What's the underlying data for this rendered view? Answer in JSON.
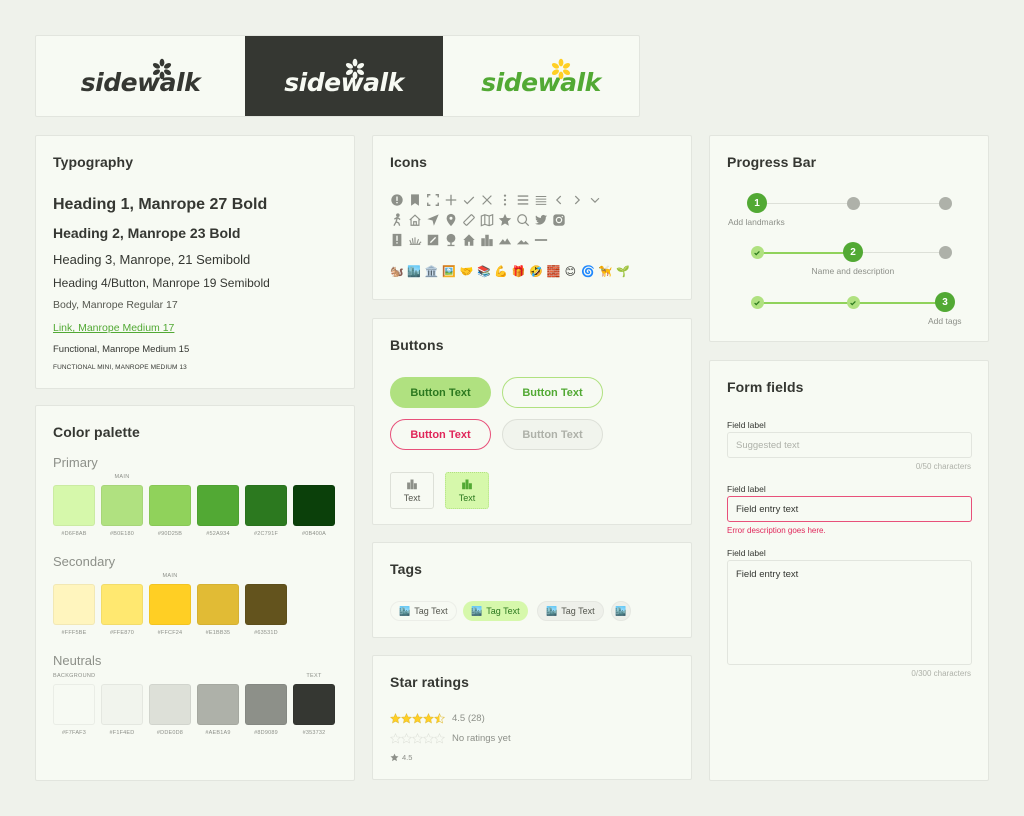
{
  "logos": {
    "wordmark": "sidewalk",
    "variants": [
      {
        "name": "dark-on-light",
        "text_color": "#353732",
        "flower_color": "#353732",
        "background": "#f7faf3"
      },
      {
        "name": "light-on-dark",
        "text_color": "#f7faf3",
        "flower_color": "#f7faf3",
        "background": "#353732"
      },
      {
        "name": "brand-color",
        "text_color": "#52a934",
        "flower_color": "#ffcf24",
        "background": "#f7faf3"
      }
    ]
  },
  "typography": {
    "title": "Typography",
    "samples": {
      "h1": "Heading 1, Manrope 27 Bold",
      "h2": "Heading 2, Manrope 23 Bold",
      "h3": "Heading 3, Manrope, 21 Semibold",
      "h4": "Heading 4/Button, Manrope 19 Semibold",
      "body": "Body, Manrope Regular 17",
      "link": "Link, Manrope Medium 17",
      "functional": "Functional, Manrope Medium 15",
      "functional_mini": "Functional mini, Manrope Medium 13"
    }
  },
  "palette": {
    "title": "Color palette",
    "primary": {
      "label": "Primary",
      "swatches": [
        {
          "hex": "#D6F8AB",
          "tag": ""
        },
        {
          "hex": "#B0E180",
          "tag": "MAIN"
        },
        {
          "hex": "#90D25B",
          "tag": ""
        },
        {
          "hex": "#52A934",
          "tag": ""
        },
        {
          "hex": "#2C791F",
          "tag": ""
        },
        {
          "hex": "#0B400A",
          "tag": ""
        }
      ]
    },
    "secondary": {
      "label": "Secondary",
      "swatches": [
        {
          "hex": "#FFF5BE",
          "tag": ""
        },
        {
          "hex": "#FFE870",
          "tag": ""
        },
        {
          "hex": "#FFCF24",
          "tag": "MAIN"
        },
        {
          "hex": "#E1BB35",
          "tag": ""
        },
        {
          "hex": "#63531D",
          "tag": ""
        }
      ]
    },
    "neutrals": {
      "label": "Neutrals",
      "swatches": [
        {
          "hex": "#F7FAF3",
          "tag": "BACKGROUND"
        },
        {
          "hex": "#F1F4ED",
          "tag": ""
        },
        {
          "hex": "#DDE0D8",
          "tag": ""
        },
        {
          "hex": "#AEB1A9",
          "tag": ""
        },
        {
          "hex": "#8D9089",
          "tag": ""
        },
        {
          "hex": "#353732",
          "tag": "TEXT"
        }
      ]
    }
  },
  "icons": {
    "title": "Icons",
    "row1": [
      "alert-circle-icon",
      "bookmark-icon",
      "fullscreen-icon",
      "plus-icon",
      "check-icon",
      "close-icon",
      "more-vertical-icon",
      "menu-icon",
      "menu-thin-icon",
      "chevron-left-icon",
      "chevron-right-icon",
      "chevron-down-icon"
    ],
    "row2": [
      "walk-icon",
      "home-icon",
      "navigation-icon",
      "map-pin-icon",
      "ruler-icon",
      "map-icon",
      "star-icon",
      "search-icon",
      "twitter-icon",
      "instagram-icon"
    ],
    "row3": [
      "info-sign-icon",
      "grass-icon",
      "edit-square-icon",
      "tree-icon",
      "house-icon",
      "buildings-icon",
      "mountain-icon",
      "hills-icon",
      "minus-icon"
    ],
    "emoji": [
      "🐿️",
      "🏙️",
      "🏛️",
      "🖼️",
      "🤝",
      "📚",
      "💪",
      "🎁",
      "🤣",
      "🧱",
      "😊",
      "🌀",
      "🦮",
      "🌱"
    ]
  },
  "buttons": {
    "title": "Buttons",
    "primary_label": "Button Text",
    "secondary_label": "Button Text",
    "danger_label": "Button Text",
    "disabled_label": "Button Text",
    "tile_default_label": "Text",
    "tile_selected_label": "Text"
  },
  "tags": {
    "title": "Tags",
    "items": [
      {
        "label": "Tag Text",
        "icon": "🏙️",
        "state": "default"
      },
      {
        "label": "Tag Text",
        "icon": "🏙️",
        "state": "selected"
      },
      {
        "label": "Tag Text",
        "icon": "🏙️",
        "state": "hover"
      },
      {
        "label": "",
        "icon": "🏙️",
        "state": "icon-only"
      }
    ]
  },
  "stars": {
    "title": "Star ratings",
    "rated": {
      "rating": 4.5,
      "max": 5,
      "text": "4.5 (28)"
    },
    "empty": {
      "rating": 0,
      "max": 5,
      "text": "No ratings yet"
    },
    "compact": {
      "rating": 4.5,
      "text": "4.5"
    }
  },
  "progress": {
    "title": "Progress Bar",
    "steps": [
      "Add landmarks",
      "Name and description",
      "Add tags"
    ],
    "examples": [
      {
        "current_step": 1,
        "label": "Add landmarks"
      },
      {
        "current_step": 2,
        "label": "Name and description"
      },
      {
        "current_step": 3,
        "label": "Add tags"
      }
    ]
  },
  "form": {
    "title": "Form fields",
    "field1": {
      "label": "Field label",
      "value": "",
      "placeholder": "Suggested text",
      "counter": "0/50 characters"
    },
    "field2": {
      "label": "Field label",
      "value": "Field entry text",
      "error": "Error description goes here."
    },
    "field3": {
      "label": "Field label",
      "value": "Field entry text",
      "counter": "0/300 characters"
    }
  },
  "colors": {
    "background": "#eff2eb",
    "card": "#f7faf3",
    "text": "#353732",
    "accent": "#52a934",
    "error": "#e0265a",
    "star": "#ffcf24"
  }
}
